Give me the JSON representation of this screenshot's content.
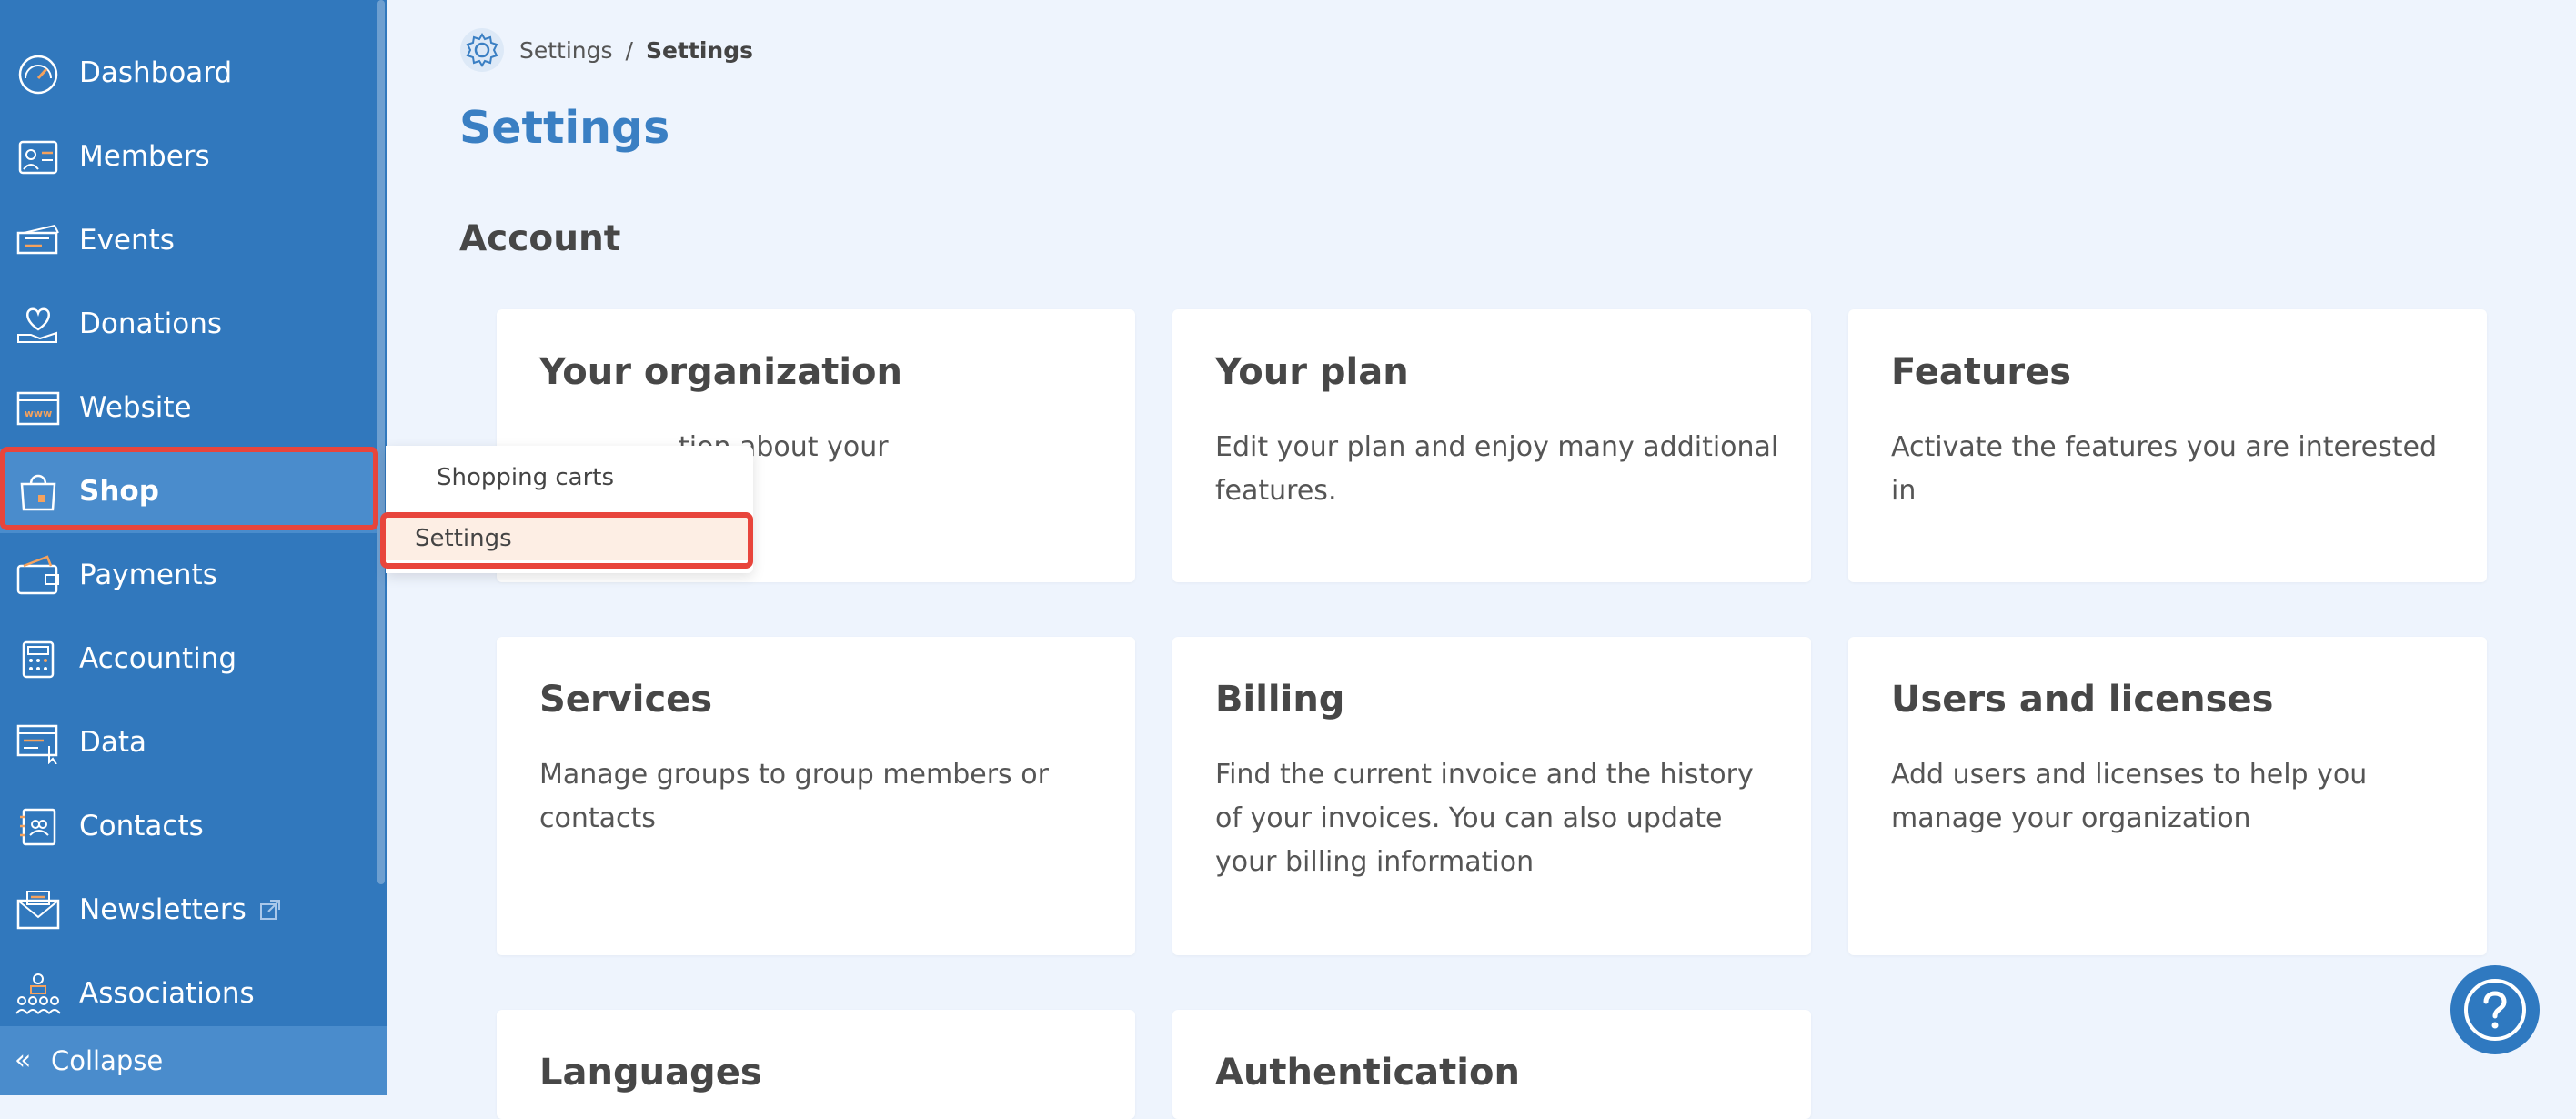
{
  "sidebar": {
    "items": [
      {
        "label": "Dashboard",
        "icon": "speedometer-icon"
      },
      {
        "label": "Members",
        "icon": "id-card-icon"
      },
      {
        "label": "Events",
        "icon": "tickets-icon"
      },
      {
        "label": "Donations",
        "icon": "heart-hand-icon"
      },
      {
        "label": "Website",
        "icon": "browser-icon"
      },
      {
        "label": "Shop",
        "icon": "shopping-bag-icon"
      },
      {
        "label": "Payments",
        "icon": "wallet-icon"
      },
      {
        "label": "Accounting",
        "icon": "calculator-icon"
      },
      {
        "label": "Data",
        "icon": "data-chart-icon"
      },
      {
        "label": "Contacts",
        "icon": "contacts-book-icon"
      },
      {
        "label": "Newsletters",
        "icon": "envelope-icon"
      },
      {
        "label": "Associations",
        "icon": "people-network-icon"
      }
    ],
    "collapse_label": "Collapse",
    "active_item": "Shop"
  },
  "flyout": {
    "items": [
      "Shopping carts",
      "Settings"
    ],
    "active_item": "Settings"
  },
  "breadcrumb": {
    "parent": "Settings",
    "separator": "/",
    "current": "Settings"
  },
  "page_title": "Settings",
  "section_title": "Account",
  "cards": [
    {
      "title": "Your organization",
      "description": "tion about your"
    },
    {
      "title": "Your plan",
      "description": "Edit your plan and enjoy many additional features."
    },
    {
      "title": "Features",
      "description": "Activate the features you are interested in"
    },
    {
      "title": "Services",
      "description": "Manage groups to group members or contacts"
    },
    {
      "title": "Billing",
      "description": "Find the current invoice and the history of your invoices. You can also update your billing information"
    },
    {
      "title": "Users and licenses",
      "description": "Add users and licenses to help you manage your organization"
    },
    {
      "title": "Languages",
      "description": ""
    },
    {
      "title": "Authentication",
      "description": ""
    }
  ],
  "colors": {
    "sidebar_bg": "#3178bd",
    "sidebar_active": "#4a8ccc",
    "highlight": "#e8453c",
    "title_blue": "#3a7fc3",
    "page_bg": "#eef4fd"
  }
}
